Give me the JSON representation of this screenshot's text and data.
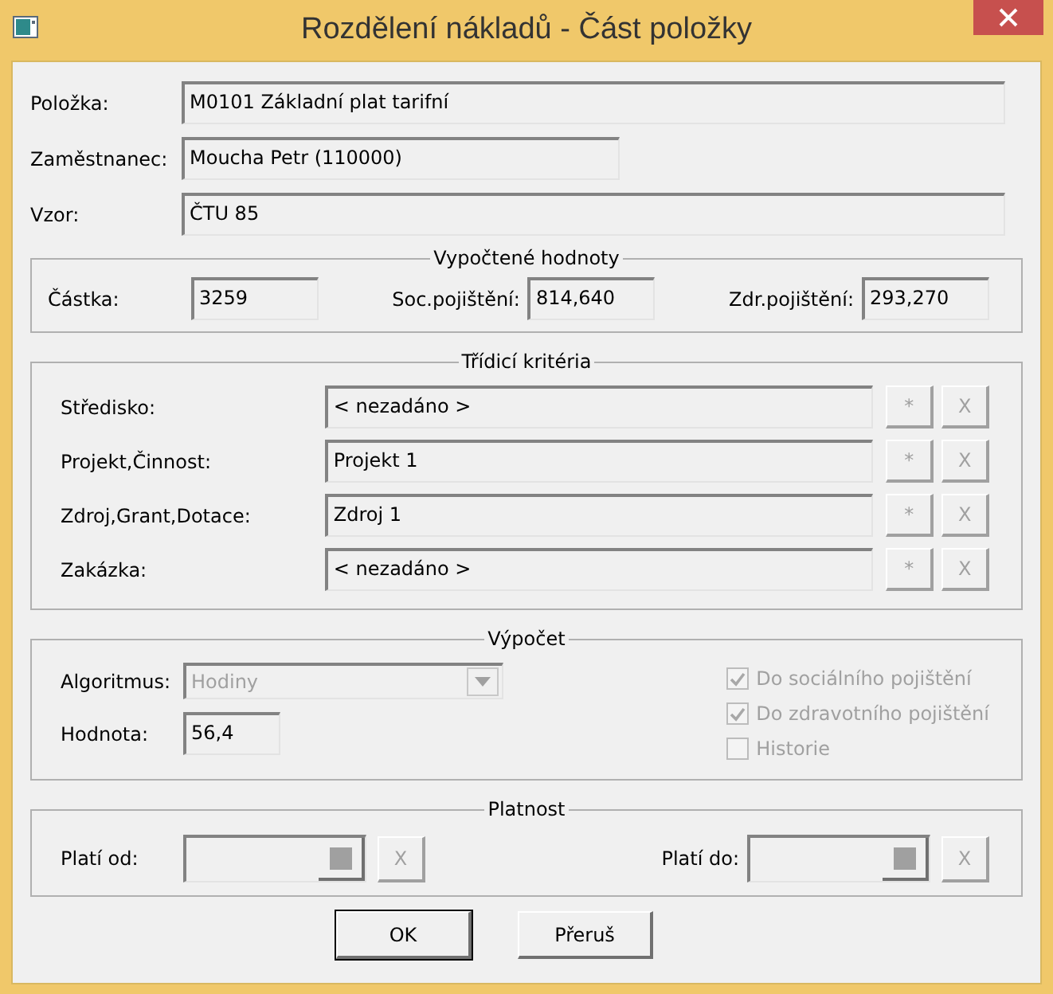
{
  "window": {
    "title": "Rozdělení nákladů - Část položky"
  },
  "fields": [
    {
      "label": "Položka:",
      "value": "M0101 Základní plat tarifní",
      "wide": true
    },
    {
      "label": "Zaměstnanec:",
      "value": "Moucha Petr (110000)",
      "wide": false
    },
    {
      "label": "Vzor:",
      "value": "ČTU 85",
      "wide": true
    }
  ],
  "calculated": {
    "title": "Vypočtené hodnoty",
    "fields": [
      {
        "label": "Částka:",
        "value": "3259"
      },
      {
        "label": "Soc.pojištění:",
        "value": "814,640"
      },
      {
        "label": "Zdr.pojištění:",
        "value": "293,270"
      }
    ]
  },
  "criteria": {
    "title": "Třídicí kritéria",
    "rows": [
      {
        "label": "Středisko:",
        "value": "< nezadáno >",
        "add_button": "*",
        "clear_button": "X",
        "disabled": true
      },
      {
        "label": "Projekt,Činnost:",
        "value": "Projekt 1",
        "add_button": "*",
        "clear_button": "X",
        "disabled": true
      },
      {
        "label": "Zdroj,Grant,Dotace:",
        "value": "Zdroj 1",
        "add_button": "*",
        "clear_button": "X",
        "disabled": true
      },
      {
        "label": "Zakázka:",
        "value": "< nezadáno >",
        "add_button": "*",
        "clear_button": "X",
        "disabled": true
      }
    ]
  },
  "calculation": {
    "title": "Výpočet",
    "algorithm": {
      "label": "Algoritmus:",
      "value": "Hodiny",
      "disabled": true
    },
    "value_field": {
      "label": "Hodnota:",
      "value": "56,4"
    },
    "options": [
      {
        "label": "Do sociálního pojištění",
        "checked": true,
        "disabled": true
      },
      {
        "label": "Do zdravotního pojištění",
        "checked": true,
        "disabled": true
      },
      {
        "label": "Historie",
        "checked": false,
        "disabled": true
      }
    ]
  },
  "validity": {
    "title": "Platnost",
    "dates": [
      {
        "label": "Platí od:",
        "clear_button": "X",
        "disabled": true
      },
      {
        "label": "Platí do:",
        "clear_button": "X",
        "disabled": true
      }
    ]
  },
  "buttons": [
    {
      "label": "OK",
      "default": true
    },
    {
      "label": "Přeruš",
      "default": false
    }
  ]
}
